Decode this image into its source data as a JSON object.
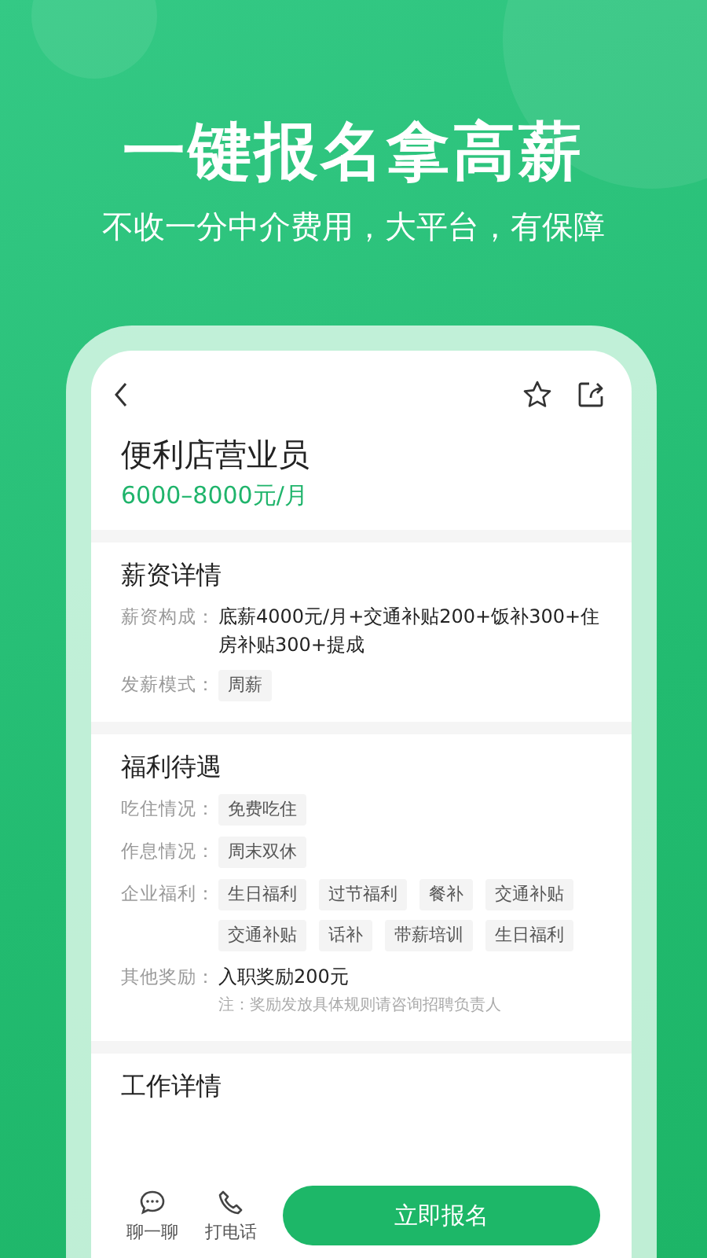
{
  "headline": "一键报名拿高薪",
  "subtitle": "不收一分中介费用，大平台，有保障",
  "job": {
    "title": "便利店营业员",
    "salary": "6000–8000元/月"
  },
  "sections": [
    {
      "title": "薪资详情",
      "rows": [
        {
          "label": "薪资构成：",
          "kind": "text",
          "value": "底薪4000元/月+交通补贴200+饭补300+住房补贴300+提成"
        },
        {
          "label": "发薪模式：",
          "kind": "tags",
          "tags": [
            "周薪"
          ]
        }
      ]
    },
    {
      "title": "福利待遇",
      "rows": [
        {
          "label": "吃住情况：",
          "kind": "tags",
          "tags": [
            "免费吃住"
          ]
        },
        {
          "label": "作息情况：",
          "kind": "tags",
          "tags": [
            "周末双休"
          ]
        },
        {
          "label": "企业福利：",
          "kind": "tags",
          "tags": [
            "生日福利",
            "过节福利",
            "餐补",
            "交通补贴",
            "交通补贴",
            "话补",
            "带薪培训",
            "生日福利"
          ]
        },
        {
          "label": "其他奖励：",
          "kind": "text",
          "value": "入职奖励200元",
          "note": "注：奖励发放具体规则请咨询招聘负责人"
        }
      ]
    },
    {
      "title": "工作详情"
    }
  ],
  "bottom_bar": {
    "actions": [
      {
        "kind": "chat",
        "label": "聊一聊"
      },
      {
        "kind": "phone",
        "label": "打电话"
      }
    ],
    "apply_button": "立即报名"
  }
}
